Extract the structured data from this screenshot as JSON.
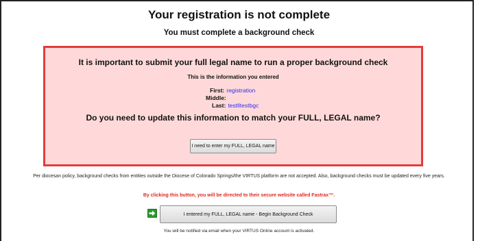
{
  "header": {
    "title": "Your registration is not complete",
    "subtitle": "You must complete a background check"
  },
  "alert": {
    "heading": "It is important to submit your full legal name to run a proper background check",
    "info_heading": "This is the information you entered",
    "fields": [
      {
        "label": "First:",
        "value": "registration"
      },
      {
        "label": "Middle:",
        "value": ""
      },
      {
        "label": "Last:",
        "value": "testlltestbgc"
      }
    ],
    "question": "Do you need to update this information to match your FULL, LEGAL name?",
    "update_button_label": "I need to enter my FULL, LEGAL name"
  },
  "policy_text": "Per diocesan policy, background checks from entities outside the Diocese of Colorado Springs/the VIRTUS platform are not accepted. Also, background checks must be updated every five years.",
  "redirect_note": "By clicking this button, you will be directed to their secure website called Fastrax™.",
  "begin_button": {
    "label": "I entered my FULL, LEGAL name - Begin Background Check",
    "icon": "arrow-right-icon"
  },
  "notify_text": "You will be notified via email when your VIRTUS Online account is activated.",
  "colors": {
    "alert_background": "#ffd9d9",
    "alert_border": "#e23b3b",
    "link_value": "#2e2ef0",
    "redirect_note": "#e0281f",
    "icon_green": "#2e9a2e"
  }
}
